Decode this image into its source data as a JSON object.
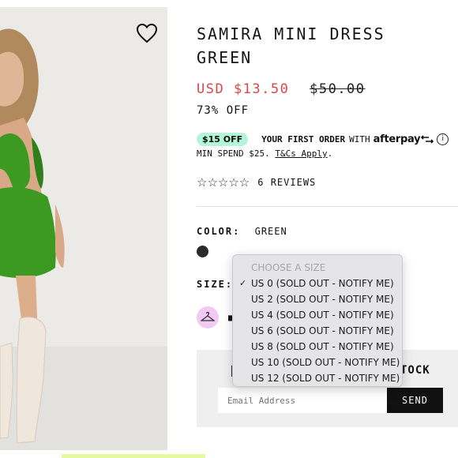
{
  "product": {
    "title": "SAMIRA MINI DRESS GREEN",
    "sale_price": "USD $13.50",
    "original_price": "$50.00",
    "discount": "73% OFF"
  },
  "afterpay": {
    "badge": "$15 OFF",
    "first_order": "YOUR FIRST ORDER",
    "with": "WITH",
    "logo": "afterpay",
    "info_icon": "i",
    "min_spend": "MIN SPEND $25.",
    "tcs": "T&Cs Apply",
    "tcs_suffix": "."
  },
  "reviews": {
    "stars": "☆☆☆☆☆",
    "rating": 0,
    "label": "6 REVIEWS"
  },
  "color": {
    "label": "COLOR:",
    "value": "GREEN",
    "swatch": "#2b2b2b"
  },
  "size": {
    "label": "SIZE:",
    "dropdown": {
      "placeholder": "CHOOSE A SIZE",
      "selected_index": 0,
      "check": "✓",
      "options": [
        "US 0 (SOLD OUT - NOTIFY ME)",
        "US 2 (SOLD OUT - NOTIFY ME)",
        "US 4 (SOLD OUT - NOTIFY ME)",
        "US 6 (SOLD OUT - NOTIFY ME)",
        "US 8 (SOLD OUT - NOTIFY ME)",
        "US 10 (SOLD OUT - NOTIFY ME)",
        "US 12 (SOLD OUT - NOTIFY ME)"
      ]
    }
  },
  "notify": {
    "title": "TOCK",
    "email_placeholder": "Email Address",
    "send_label": "SEND"
  },
  "icons": {
    "wishlist": "heart-icon",
    "size_guide": "hanger-icon",
    "info": "info-icon"
  },
  "colors": {
    "sale": "#d8474f",
    "afterpay_badge": "#b3f5d9",
    "hanger_bg": "#f1c9f3",
    "dress": "#3c9a22"
  }
}
